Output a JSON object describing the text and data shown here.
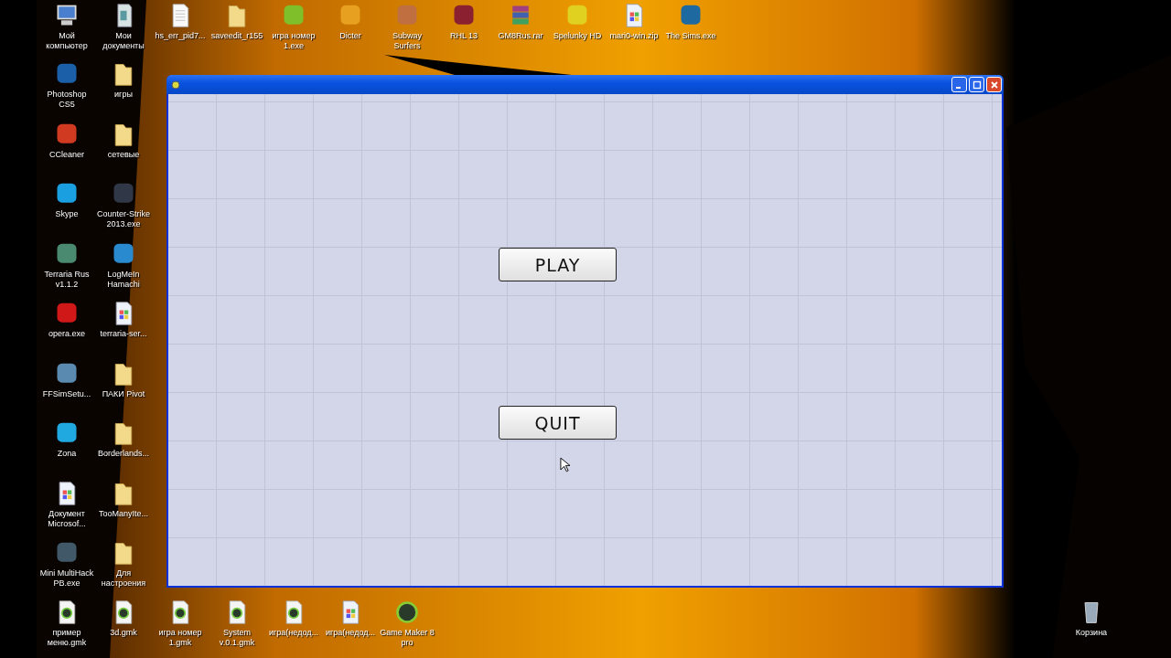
{
  "desktop": {
    "top_row": [
      {
        "label": "Мой компьютер",
        "kind": "computer"
      },
      {
        "label": "Мои документы",
        "kind": "documents"
      },
      {
        "label": "hs_err_pid7...",
        "kind": "file"
      },
      {
        "label": "saveedit_r155",
        "kind": "folder"
      },
      {
        "label": "игра номер 1.exe",
        "kind": "app",
        "color": "#7fbf2a"
      },
      {
        "label": "Dicter",
        "kind": "app",
        "color": "#e8a020"
      },
      {
        "label": "Subway Surfers",
        "kind": "app",
        "color": "#c07040"
      },
      {
        "label": "RHL 13",
        "kind": "app",
        "color": "#8a2030"
      },
      {
        "label": "GM8Rus.rar",
        "kind": "archive"
      },
      {
        "label": "Spelunky HD",
        "kind": "app",
        "color": "#e0d020"
      },
      {
        "label": "mari0-win.zip",
        "kind": "doc"
      },
      {
        "label": "The Sims.exe",
        "kind": "app",
        "color": "#1e6aa0"
      }
    ],
    "left_rows": [
      [
        {
          "label": "Photoshop CS5",
          "kind": "app",
          "color": "#1b5fa8"
        },
        {
          "label": "игры",
          "kind": "folder"
        }
      ],
      [
        {
          "label": "CCleaner",
          "kind": "app",
          "color": "#d03a20"
        },
        {
          "label": "сетевые",
          "kind": "folder"
        }
      ],
      [
        {
          "label": "Skype",
          "kind": "app",
          "color": "#1aa0e0"
        },
        {
          "label": "Counter-Strike 2013.exe",
          "kind": "app",
          "color": "#303848"
        }
      ],
      [
        {
          "label": "Terraria Rus v1.1.2",
          "kind": "app",
          "color": "#4a8a70"
        },
        {
          "label": "LogMeIn Hamachi",
          "kind": "app",
          "color": "#2a8ad0"
        }
      ],
      [
        {
          "label": "opera.exe",
          "kind": "app",
          "color": "#d01818"
        },
        {
          "label": "terraria-ser...",
          "kind": "doc"
        }
      ],
      [
        {
          "label": "FFSimSetu...",
          "kind": "app",
          "color": "#5a8ab0"
        },
        {
          "label": "ПАКИ Pivot",
          "kind": "folder"
        }
      ],
      [
        {
          "label": "Zona",
          "kind": "app",
          "color": "#20a8e0"
        },
        {
          "label": "Borderlands...",
          "kind": "folder"
        }
      ],
      [
        {
          "label": "Документ Microsof...",
          "kind": "doc"
        },
        {
          "label": "TooManyIte...",
          "kind": "folder"
        }
      ],
      [
        {
          "label": "Mini MultiHack PB.exe",
          "kind": "app",
          "color": "#405868"
        },
        {
          "label": "Для настроения",
          "kind": "folder"
        }
      ]
    ],
    "bottom_row": [
      {
        "label": "пример меню.gmk",
        "kind": "gmk"
      },
      {
        "label": "3d.gmk",
        "kind": "gmk"
      },
      {
        "label": "игра номер 1.gmk",
        "kind": "gmk"
      },
      {
        "label": "System v.0.1.gmk",
        "kind": "gmk"
      },
      {
        "label": "игра(недод...",
        "kind": "gmk"
      },
      {
        "label": "игра(недод...",
        "kind": "doc"
      },
      {
        "label": "Game Maker 8 pro",
        "kind": "app",
        "color": "#2a3a2a"
      }
    ],
    "recycle_bin": {
      "label": "Корзина"
    }
  },
  "window": {
    "buttons": [
      "PLAY",
      "QUIT"
    ]
  }
}
